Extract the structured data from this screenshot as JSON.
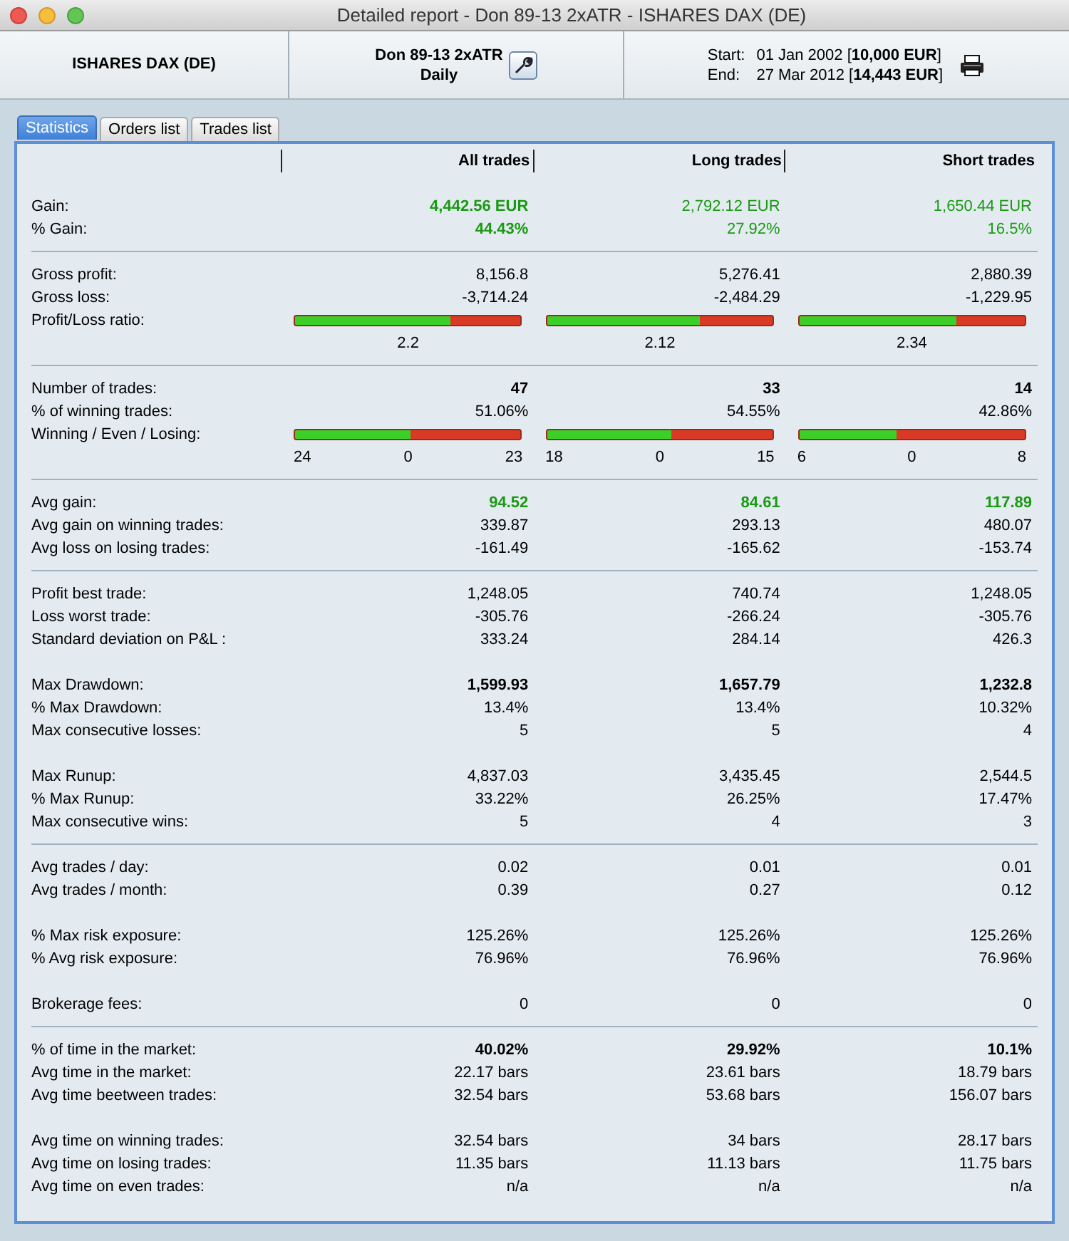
{
  "window": {
    "title": "Detailed report - Don 89-13 2xATR - ISHARES DAX (DE)"
  },
  "header": {
    "instrument": "ISHARES DAX (DE)",
    "strategy": "Don 89-13 2xATR",
    "timeframe": "Daily",
    "start_label": "Start:",
    "start_value": "01 Jan 2002 [**10,000 EUR**]",
    "end_label": "End:",
    "end_value": "27 Mar 2012 [**14,443 EUR**]"
  },
  "tabs": [
    {
      "label": "Statistics",
      "selected": true
    },
    {
      "label": "Orders list",
      "selected": false
    },
    {
      "label": "Trades list",
      "selected": false
    }
  ],
  "columns": [
    "All trades",
    "Long trades",
    "Short trades"
  ],
  "sections": [
    {
      "rule": false,
      "rows": [
        {
          "kind": "value",
          "label": "Gain:",
          "cells": [
            {
              "text": "4,442.56 EUR",
              "bold": true,
              "positive": true
            },
            {
              "text": "2,792.12 EUR",
              "bold": false,
              "positive": true
            },
            {
              "text": "1,650.44 EUR",
              "bold": false,
              "positive": true
            }
          ]
        },
        {
          "kind": "value",
          "label": "% Gain:",
          "cells": [
            {
              "text": "44.43%",
              "bold": true,
              "positive": true
            },
            {
              "text": "27.92%",
              "bold": false,
              "positive": true
            },
            {
              "text": "16.5%",
              "bold": false,
              "positive": true
            }
          ]
        }
      ]
    },
    {
      "rule": true,
      "rows": [
        {
          "kind": "value",
          "label": "Gross profit:",
          "cells": [
            {
              "text": "8,156.8",
              "bold": false,
              "positive": false
            },
            {
              "text": "5,276.41",
              "bold": false,
              "positive": false
            },
            {
              "text": "2,880.39",
              "bold": false,
              "positive": false
            }
          ]
        },
        {
          "kind": "value",
          "label": "Gross loss:",
          "cells": [
            {
              "text": "-3,714.24",
              "bold": false,
              "positive": false
            },
            {
              "text": "-2,484.29",
              "bold": false,
              "positive": false
            },
            {
              "text": "-1,229.95",
              "bold": false,
              "positive": false
            }
          ]
        },
        {
          "kind": "ratio_bar",
          "label": "Profit/Loss ratio:",
          "cells": [
            {
              "level": 0.69,
              "text": "2.2"
            },
            {
              "level": 0.68,
              "text": "2.12"
            },
            {
              "level": 0.7,
              "text": "2.34"
            }
          ]
        }
      ]
    },
    {
      "rule": true,
      "rows": [
        {
          "kind": "value",
          "label": "Number of trades:",
          "cells": [
            {
              "text": "47",
              "bold": true,
              "positive": false
            },
            {
              "text": "33",
              "bold": true,
              "positive": false
            },
            {
              "text": "14",
              "bold": true,
              "positive": false
            }
          ]
        },
        {
          "kind": "value",
          "label": "% of winning trades:",
          "cells": [
            {
              "text": "51.06%",
              "bold": false,
              "positive": false
            },
            {
              "text": "54.55%",
              "bold": false,
              "positive": false
            },
            {
              "text": "42.86%",
              "bold": false,
              "positive": false
            }
          ]
        },
        {
          "kind": "split_bar",
          "label": "Winning / Even / Losing:",
          "cells": [
            {
              "level": 0.51,
              "winning": "24",
              "even": "0",
              "losing": "23"
            },
            {
              "level": 0.55,
              "winning": "18",
              "even": "0",
              "losing": "15"
            },
            {
              "level": 0.43,
              "winning": "6",
              "even": "0",
              "losing": "8"
            }
          ]
        }
      ]
    },
    {
      "rule": true,
      "rows": [
        {
          "kind": "value",
          "label": "Avg gain:",
          "cells": [
            {
              "text": "94.52",
              "bold": true,
              "positive": true
            },
            {
              "text": "84.61",
              "bold": true,
              "positive": true
            },
            {
              "text": "117.89",
              "bold": true,
              "positive": true
            }
          ]
        },
        {
          "kind": "value",
          "label": "Avg gain on winning trades:",
          "cells": [
            {
              "text": "339.87",
              "bold": false,
              "positive": false
            },
            {
              "text": "293.13",
              "bold": false,
              "positive": false
            },
            {
              "text": "480.07",
              "bold": false,
              "positive": false
            }
          ]
        },
        {
          "kind": "value",
          "label": "Avg loss on losing trades:",
          "cells": [
            {
              "text": "-161.49",
              "bold": false,
              "positive": false
            },
            {
              "text": "-165.62",
              "bold": false,
              "positive": false
            },
            {
              "text": "-153.74",
              "bold": false,
              "positive": false
            }
          ]
        }
      ]
    },
    {
      "rule": true,
      "rows": [
        {
          "kind": "value",
          "label": "Profit best trade:",
          "cells": [
            {
              "text": "1,248.05",
              "bold": false,
              "positive": false
            },
            {
              "text": "740.74",
              "bold": false,
              "positive": false
            },
            {
              "text": "1,248.05",
              "bold": false,
              "positive": false
            }
          ]
        },
        {
          "kind": "value",
          "label": "Loss worst trade:",
          "cells": [
            {
              "text": "-305.76",
              "bold": false,
              "positive": false
            },
            {
              "text": "-266.24",
              "bold": false,
              "positive": false
            },
            {
              "text": "-305.76",
              "bold": false,
              "positive": false
            }
          ]
        },
        {
          "kind": "value",
          "label": "Standard deviation on P&L :",
          "cells": [
            {
              "text": "333.24",
              "bold": false,
              "positive": false
            },
            {
              "text": "284.14",
              "bold": false,
              "positive": false
            },
            {
              "text": "426.3",
              "bold": false,
              "positive": false
            }
          ]
        }
      ]
    },
    {
      "rule": false,
      "rows": [
        {
          "kind": "value",
          "label": "Max Drawdown:",
          "cells": [
            {
              "text": "1,599.93",
              "bold": true,
              "positive": false
            },
            {
              "text": "1,657.79",
              "bold": true,
              "positive": false
            },
            {
              "text": "1,232.8",
              "bold": true,
              "positive": false
            }
          ]
        },
        {
          "kind": "value",
          "label": "% Max Drawdown:",
          "cells": [
            {
              "text": "13.4%",
              "bold": false,
              "positive": false
            },
            {
              "text": "13.4%",
              "bold": false,
              "positive": false
            },
            {
              "text": "10.32%",
              "bold": false,
              "positive": false
            }
          ]
        },
        {
          "kind": "value",
          "label": "Max consecutive losses:",
          "cells": [
            {
              "text": "5",
              "bold": false,
              "positive": false
            },
            {
              "text": "5",
              "bold": false,
              "positive": false
            },
            {
              "text": "4",
              "bold": false,
              "positive": false
            }
          ]
        }
      ]
    },
    {
      "rule": false,
      "rows": [
        {
          "kind": "value",
          "label": "Max Runup:",
          "cells": [
            {
              "text": "4,837.03",
              "bold": false,
              "positive": false
            },
            {
              "text": "3,435.45",
              "bold": false,
              "positive": false
            },
            {
              "text": "2,544.5",
              "bold": false,
              "positive": false
            }
          ]
        },
        {
          "kind": "value",
          "label": "% Max Runup:",
          "cells": [
            {
              "text": "33.22%",
              "bold": false,
              "positive": false
            },
            {
              "text": "26.25%",
              "bold": false,
              "positive": false
            },
            {
              "text": "17.47%",
              "bold": false,
              "positive": false
            }
          ]
        },
        {
          "kind": "value",
          "label": "Max consecutive wins:",
          "cells": [
            {
              "text": "5",
              "bold": false,
              "positive": false
            },
            {
              "text": "4",
              "bold": false,
              "positive": false
            },
            {
              "text": "3",
              "bold": false,
              "positive": false
            }
          ]
        }
      ]
    },
    {
      "rule": true,
      "rows": [
        {
          "kind": "value",
          "label": "Avg trades / day:",
          "cells": [
            {
              "text": "0.02",
              "bold": false,
              "positive": false
            },
            {
              "text": "0.01",
              "bold": false,
              "positive": false
            },
            {
              "text": "0.01",
              "bold": false,
              "positive": false
            }
          ]
        },
        {
          "kind": "value",
          "label": "Avg trades / month:",
          "cells": [
            {
              "text": "0.39",
              "bold": false,
              "positive": false
            },
            {
              "text": "0.27",
              "bold": false,
              "positive": false
            },
            {
              "text": "0.12",
              "bold": false,
              "positive": false
            }
          ]
        }
      ]
    },
    {
      "rule": false,
      "rows": [
        {
          "kind": "value",
          "label": "% Max risk exposure:",
          "cells": [
            {
              "text": "125.26%",
              "bold": false,
              "positive": false
            },
            {
              "text": "125.26%",
              "bold": false,
              "positive": false
            },
            {
              "text": "125.26%",
              "bold": false,
              "positive": false
            }
          ]
        },
        {
          "kind": "value",
          "label": "% Avg risk exposure:",
          "cells": [
            {
              "text": "76.96%",
              "bold": false,
              "positive": false
            },
            {
              "text": "76.96%",
              "bold": false,
              "positive": false
            },
            {
              "text": "76.96%",
              "bold": false,
              "positive": false
            }
          ]
        }
      ]
    },
    {
      "rule": false,
      "rows": [
        {
          "kind": "value",
          "label": "Brokerage fees:",
          "cells": [
            {
              "text": "0",
              "bold": false,
              "positive": false
            },
            {
              "text": "0",
              "bold": false,
              "positive": false
            },
            {
              "text": "0",
              "bold": false,
              "positive": false
            }
          ]
        }
      ]
    },
    {
      "rule": true,
      "rows": [
        {
          "kind": "value",
          "label": "% of time in the market:",
          "cells": [
            {
              "text": "40.02%",
              "bold": true,
              "positive": false
            },
            {
              "text": "29.92%",
              "bold": true,
              "positive": false
            },
            {
              "text": "10.1%",
              "bold": true,
              "positive": false
            }
          ]
        },
        {
          "kind": "value",
          "label": "Avg time in the market:",
          "cells": [
            {
              "text": "22.17 bars",
              "bold": false,
              "positive": false
            },
            {
              "text": "23.61 bars",
              "bold": false,
              "positive": false
            },
            {
              "text": "18.79 bars",
              "bold": false,
              "positive": false
            }
          ]
        },
        {
          "kind": "value",
          "label": "Avg time beetween trades:",
          "cells": [
            {
              "text": "32.54 bars",
              "bold": false,
              "positive": false
            },
            {
              "text": "53.68 bars",
              "bold": false,
              "positive": false
            },
            {
              "text": "156.07 bars",
              "bold": false,
              "positive": false
            }
          ]
        }
      ]
    },
    {
      "rule": false,
      "rows": [
        {
          "kind": "value",
          "label": "Avg time on winning trades:",
          "cells": [
            {
              "text": "32.54 bars",
              "bold": false,
              "positive": false
            },
            {
              "text": "34 bars",
              "bold": false,
              "positive": false
            },
            {
              "text": "28.17 bars",
              "bold": false,
              "positive": false
            }
          ]
        },
        {
          "kind": "value",
          "label": "Avg time on losing trades:",
          "cells": [
            {
              "text": "11.35 bars",
              "bold": false,
              "positive": false
            },
            {
              "text": "11.13 bars",
              "bold": false,
              "positive": false
            },
            {
              "text": "11.75 bars",
              "bold": false,
              "positive": false
            }
          ]
        },
        {
          "kind": "value",
          "label": "Avg time on even trades:",
          "cells": [
            {
              "text": "n/a",
              "bold": false,
              "positive": false
            },
            {
              "text": "n/a",
              "bold": false,
              "positive": false
            },
            {
              "text": "n/a",
              "bold": false,
              "positive": false
            }
          ]
        }
      ]
    }
  ]
}
